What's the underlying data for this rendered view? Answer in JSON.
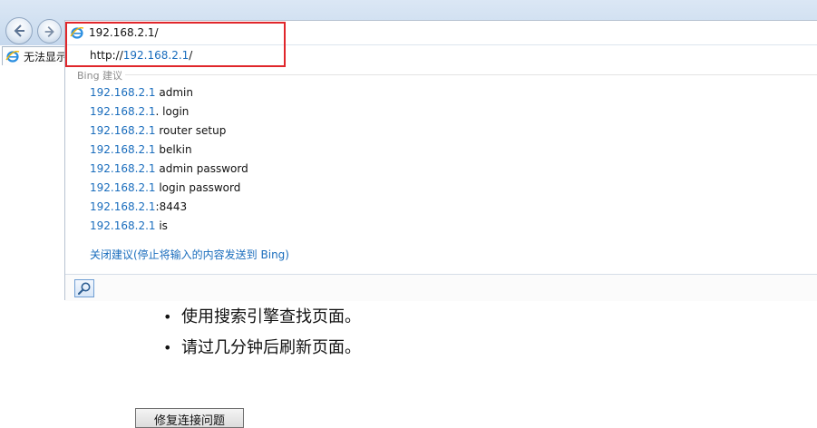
{
  "browser": {
    "tab_title": "无法显示此页",
    "address_value": "192.168.2.1/",
    "url_suggestion": {
      "prefix": "http://",
      "host": "192.168.2.1",
      "suffix": "/"
    },
    "bing_header": "Bing 建议",
    "search_suggestions": [
      {
        "query": "192.168.2.1",
        "rest": " admin"
      },
      {
        "query": "192.168.2.1",
        "rest": ". login"
      },
      {
        "query": "192.168.2.1",
        "rest": " router setup"
      },
      {
        "query": "192.168.2.1",
        "rest": " belkin"
      },
      {
        "query": "192.168.2.1",
        "rest": " admin password"
      },
      {
        "query": "192.168.2.1",
        "rest": " login password"
      },
      {
        "query": "192.168.2.1",
        "rest": ":8443"
      },
      {
        "query": "192.168.2.1",
        "rest": " is"
      }
    ],
    "close_suggestions": "关闭建议(停止将输入的内容发送到 Bing)",
    "icons": {
      "back": "back-arrow-icon",
      "forward": "forward-arrow-icon",
      "site": "ie-icon",
      "search": "magnifier-icon"
    },
    "colors": {
      "highlight": "#1a6dbd",
      "annotation_box": "#e0262b"
    }
  },
  "page": {
    "bullets": [
      "使用搜索引擎查找页面。",
      "请过几分钟后刷新页面。"
    ],
    "fix_button": "修复连接问题"
  }
}
